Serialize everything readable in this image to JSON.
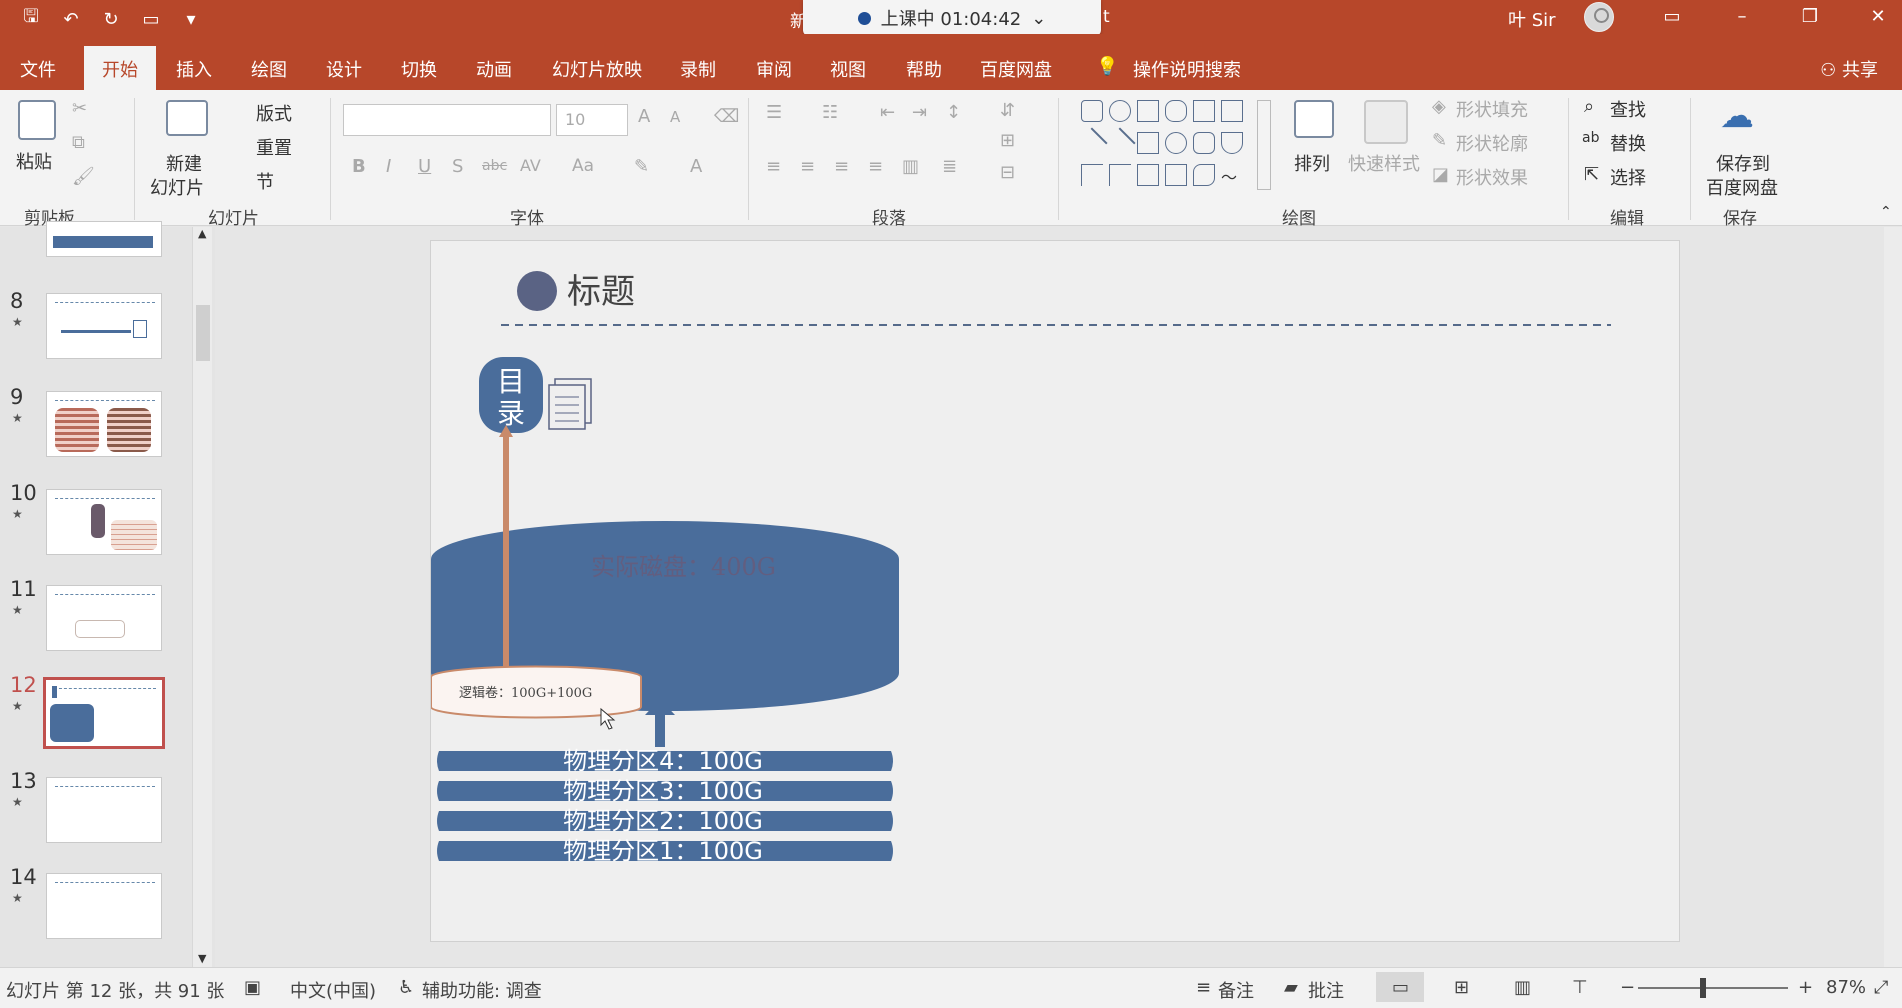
{
  "titlebar": {
    "doc_title_left": "新",
    "doc_title_right": "t",
    "recording": "上课中 01:04:42",
    "user": "叶 Sir",
    "share": "共享"
  },
  "tabs": [
    "文件",
    "开始",
    "插入",
    "绘图",
    "设计",
    "切换",
    "动画",
    "幻灯片放映",
    "录制",
    "审阅",
    "视图",
    "帮助",
    "百度网盘",
    "操作说明搜索"
  ],
  "active_tab": "开始",
  "ribbon": {
    "clipboard": {
      "paste": "粘贴",
      "label": "剪贴板"
    },
    "slides": {
      "new_line1": "新建",
      "new_line2": "幻灯片",
      "layout": "版式",
      "reset": "重置",
      "section": "节",
      "label": "幻灯片"
    },
    "font": {
      "size": "10",
      "label": "字体",
      "bold": "B",
      "italic": "I",
      "underline": "U",
      "strike": "S",
      "shadow": "abc",
      "spacing": "AV",
      "case": "Aa",
      "grow": "A",
      "shrink": "A",
      "color": "A"
    },
    "paragraph": {
      "label": "段落"
    },
    "drawing": {
      "arrange": "排列",
      "quick_styles": "快速样式",
      "fill": "形状填充",
      "outline": "形状轮廓",
      "effects": "形状效果",
      "label": "绘图"
    },
    "editing": {
      "find": "查找",
      "replace": "替换",
      "select": "选择",
      "label": "编辑"
    },
    "save": {
      "line1": "保存到",
      "line2": "百度网盘",
      "label": "保存"
    }
  },
  "slides_pane": [
    {
      "num": "8"
    },
    {
      "num": "9"
    },
    {
      "num": "10"
    },
    {
      "num": "11"
    },
    {
      "num": "12",
      "selected": true
    },
    {
      "num": "13"
    },
    {
      "num": "14"
    }
  ],
  "slide": {
    "title": "标题",
    "directory_line1": "目",
    "directory_line2": "录",
    "disk_label": "实际磁盘：400G",
    "logical_volume": "逻辑卷：100G+100G",
    "partitions": [
      "物理分区4：100G",
      "物理分区3：100G",
      "物理分区2：100G",
      "物理分区1：100G"
    ]
  },
  "status": {
    "slide_info": "幻灯片 第 12 张，共 91 张",
    "language": "中文(中国)",
    "accessibility": "辅助功能: 调查",
    "notes": "备注",
    "comments": "批注",
    "zoom": "87%"
  },
  "colors": {
    "accent": "#b7472a",
    "slide_blue": "#4a6d9b",
    "pipe": "#c98a6a"
  }
}
